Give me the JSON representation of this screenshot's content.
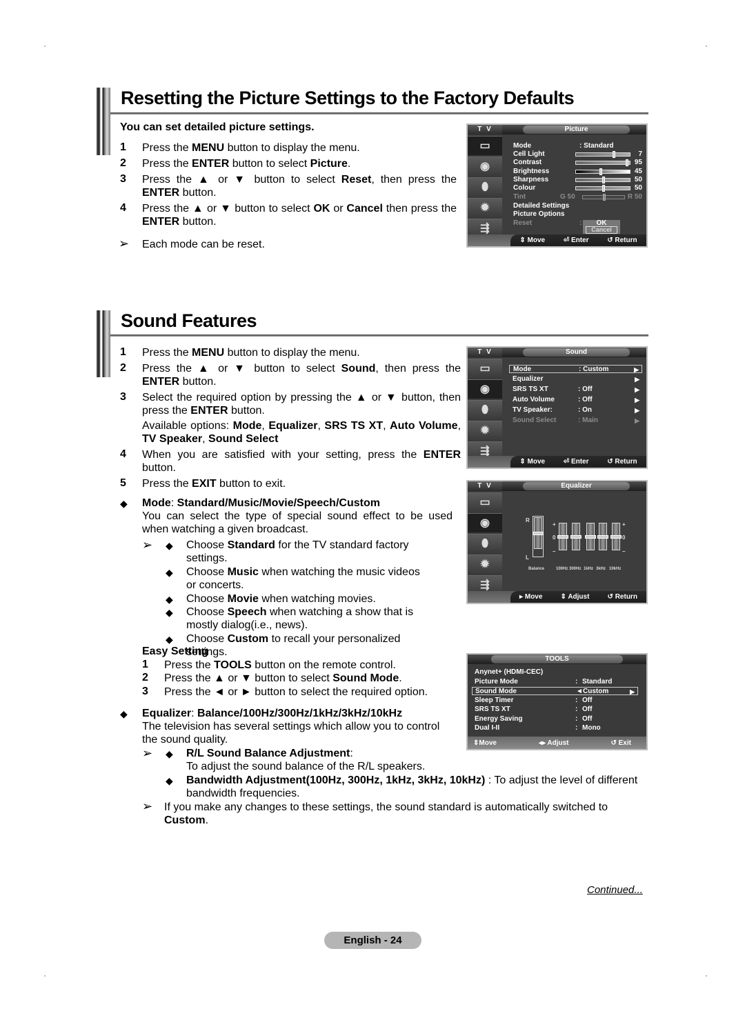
{
  "section1": {
    "title": "Resetting the Picture Settings to the Factory Defaults",
    "intro": "You can set detailed picture settings.",
    "steps": [
      {
        "n": "1",
        "parts": [
          [
            "Press the ",
            false
          ],
          [
            "MENU",
            true
          ],
          [
            " button to display the menu.",
            false
          ]
        ]
      },
      {
        "n": "2",
        "parts": [
          [
            "Press the ",
            false
          ],
          [
            "ENTER",
            true
          ],
          [
            " button to select ",
            false
          ],
          [
            "Picture",
            true
          ],
          [
            ".",
            false
          ]
        ]
      },
      {
        "n": "3",
        "parts": [
          [
            "Press the ▲ or ▼ button to select ",
            false
          ],
          [
            "Reset",
            true
          ],
          [
            ", then press the ",
            false
          ],
          [
            "ENTER",
            true
          ],
          [
            " button.",
            false
          ]
        ]
      },
      {
        "n": "4",
        "parts": [
          [
            "Press the ▲ or ▼ button to select ",
            false
          ],
          [
            "OK",
            true
          ],
          [
            " or ",
            false
          ],
          [
            "Cancel",
            true
          ],
          [
            " then press the ",
            false
          ],
          [
            "ENTER",
            true
          ],
          [
            " button.",
            false
          ]
        ]
      }
    ],
    "note": "Each mode can be reset."
  },
  "osd_picture": {
    "tv_label": "T V",
    "title": "Picture",
    "icons": [
      "picture-icon",
      "sound-icon",
      "channel-icon",
      "setup-icon",
      "input-icon"
    ],
    "mode_label": "Mode",
    "mode_value": ": Standard",
    "sliders": [
      {
        "label": "Cell Light",
        "value": "7",
        "level": 7,
        "max": 10,
        "dim": false
      },
      {
        "label": "Contrast",
        "value": "95",
        "level": 95,
        "max": 100,
        "dim": false
      },
      {
        "label": "Brightness",
        "value": "45",
        "level": 45,
        "max": 100,
        "dim": false
      },
      {
        "label": "Sharpness",
        "value": "50",
        "level": 50,
        "max": 100,
        "dim": false
      },
      {
        "label": "Colour",
        "value": "50",
        "level": 50,
        "max": 100,
        "dim": false
      }
    ],
    "tint": {
      "label": "Tint",
      "left": "G  50",
      "right": "R  50",
      "level": 50
    },
    "detailed": "Detailed Settings",
    "options": "Picture Options",
    "reset_label": "Reset",
    "reset_sep": ":",
    "ok": "OK",
    "cancel": "Cancel",
    "footer": {
      "move": "Move",
      "enter": "Enter",
      "return": "Return"
    }
  },
  "section2": {
    "title": "Sound Features",
    "steps": [
      {
        "n": "1",
        "parts": [
          [
            "Press the ",
            false
          ],
          [
            "MENU",
            true
          ],
          [
            " button to display the menu.",
            false
          ]
        ]
      },
      {
        "n": "2",
        "parts": [
          [
            "Press the ▲ or ▼ button to select ",
            false
          ],
          [
            "Sound",
            true
          ],
          [
            ", then press the ",
            false
          ],
          [
            "ENTER",
            true
          ],
          [
            " button.",
            false
          ]
        ]
      },
      {
        "n": "3",
        "parts": [
          [
            "Select the required option by pressing the ▲ or ▼ button, then press the ",
            false
          ],
          [
            "ENTER",
            true
          ],
          [
            " button.",
            false
          ]
        ]
      },
      {
        "n": "",
        "parts": [
          [
            "Available options: ",
            false
          ],
          [
            "Mode",
            true
          ],
          [
            ", ",
            false
          ],
          [
            "Equalizer",
            true
          ],
          [
            ", ",
            false
          ],
          [
            "SRS TS XT",
            true
          ],
          [
            ", ",
            false
          ],
          [
            "Auto Volume",
            true
          ],
          [
            ", ",
            false
          ],
          [
            "TV Speaker",
            true
          ],
          [
            ", ",
            false
          ],
          [
            "Sound Select",
            true
          ]
        ]
      },
      {
        "n": "4",
        "parts": [
          [
            "When you are satisfied with your setting, press the ",
            false
          ],
          [
            "ENTER",
            true
          ],
          [
            " button.",
            false
          ]
        ]
      },
      {
        "n": "5",
        "parts": [
          [
            "Press the ",
            false
          ],
          [
            "EXIT",
            true
          ],
          [
            " button to exit.",
            false
          ]
        ]
      }
    ],
    "mode_heading": [
      [
        "Mode",
        true
      ],
      [
        ": ",
        false
      ],
      [
        "Standard/Music/Movie/Speech/Custom",
        true
      ]
    ],
    "mode_desc": "You can select the type of special sound effect to be used when watching a given broadcast.",
    "mode_bullets": [
      [
        [
          "Choose ",
          false
        ],
        [
          "Standard",
          true
        ],
        [
          " for the TV standard factory settings.",
          false
        ]
      ],
      [
        [
          "Choose ",
          false
        ],
        [
          "Music",
          true
        ],
        [
          " when watching the music videos or concerts.",
          false
        ]
      ],
      [
        [
          "Choose ",
          false
        ],
        [
          "Movie",
          true
        ],
        [
          " when watching movies.",
          false
        ]
      ],
      [
        [
          "Choose ",
          false
        ],
        [
          "Speech",
          true
        ],
        [
          " when watching a show that is mostly dialog(i.e., news).",
          false
        ]
      ],
      [
        [
          "Choose ",
          false
        ],
        [
          "Custom",
          true
        ],
        [
          " to recall your personalized settings.",
          false
        ]
      ]
    ],
    "easy_heading": "Easy Setting",
    "easy_steps": [
      {
        "n": "1",
        "parts": [
          [
            "Press the ",
            false
          ],
          [
            "TOOLS",
            true
          ],
          [
            " button on the remote control.",
            false
          ]
        ]
      },
      {
        "n": "2",
        "parts": [
          [
            "Press the ▲ or ▼ button to select ",
            false
          ],
          [
            "Sound Mode",
            true
          ],
          [
            ".",
            false
          ]
        ]
      },
      {
        "n": "3",
        "parts": [
          [
            "Press the ◄ or ► button to select the required option.",
            false
          ]
        ]
      }
    ],
    "eq_heading": [
      [
        "Equalizer",
        true
      ],
      [
        ": ",
        false
      ],
      [
        "Balance/100Hz/300Hz/1kHz/3kHz/10kHz",
        true
      ]
    ],
    "eq_desc": "The television has several settings which allow you to control the sound quality.",
    "eq_bullets": [
      {
        "head": "R/L Sound Balance Adjustment",
        "tail": ":",
        "desc": "To adjust the sound balance of the R/L speakers."
      },
      {
        "head": "Bandwidth Adjustment(100Hz, 300Hz, 1kHz, 3kHz, 10kHz)",
        "tail": " : To adjust the level of different bandwidth frequencies.",
        "desc": ""
      }
    ],
    "final_note": [
      [
        "If you make any changes to these settings, the sound standard is automatically switched to ",
        false
      ],
      [
        "Custom",
        true
      ],
      [
        ".",
        false
      ]
    ]
  },
  "osd_sound": {
    "tv_label": "T V",
    "title": "Sound",
    "rows": [
      {
        "label": "Mode",
        "value": ": Custom",
        "chev": "▶",
        "dim": false,
        "selected": true
      },
      {
        "label": "Equalizer",
        "value": "",
        "chev": "▶",
        "dim": false,
        "selected": false
      },
      {
        "label": "SRS TS XT",
        "value": ": Off",
        "chev": "▶",
        "dim": false,
        "selected": false
      },
      {
        "label": "Auto Volume",
        "value": ": Off",
        "chev": "▶",
        "dim": false,
        "selected": false
      },
      {
        "label": "TV Speaker:",
        "value": ": On",
        "chev": "▶",
        "dim": false,
        "selected": false
      },
      {
        "label": "Sound Select",
        "value": ": Main",
        "chev": "▶",
        "dim": true,
        "selected": false
      }
    ],
    "footer": {
      "move": "Move",
      "enter": "Enter",
      "return": "Return"
    }
  },
  "osd_equalizer": {
    "tv_label": "T V",
    "title": "Equalizer",
    "balance_top": "R",
    "balance_bottom": "L",
    "plus": "+",
    "zero": "0",
    "minus": "–",
    "bands": [
      {
        "label": "Balance",
        "level": 0
      },
      {
        "label": "100Hz",
        "level": 0
      },
      {
        "label": "300Hz",
        "level": 0
      },
      {
        "label": "1kHz",
        "level": 0
      },
      {
        "label": "3kHz",
        "level": 0
      },
      {
        "label": "10kHz",
        "level": 0
      }
    ],
    "footer": {
      "move": "Move",
      "adjust": "Adjust",
      "return": "Return"
    }
  },
  "osd_tools": {
    "title": "TOOLS",
    "rows": [
      {
        "label": "Anynet+ (HDMI-CEC)",
        "sep": "",
        "value": "",
        "selected": false
      },
      {
        "label": "Picture Mode",
        "sep": ":",
        "value": "Standard",
        "selected": false
      },
      {
        "label": "Sound Mode",
        "sep": "◄",
        "value": "Custom",
        "selected": true,
        "chev": "▶"
      },
      {
        "label": "Sleep Timer",
        "sep": ":",
        "value": "Off",
        "selected": false
      },
      {
        "label": "SRS TS XT",
        "sep": ":",
        "value": "Off",
        "selected": false
      },
      {
        "label": "Energy Saving",
        "sep": ":",
        "value": "Off",
        "selected": false
      },
      {
        "label": "Dual I-II",
        "sep": ":",
        "value": "Mono",
        "selected": false
      }
    ],
    "footer": {
      "move": "Move",
      "adjust": "Adjust",
      "exit": "Exit"
    }
  },
  "continued": "Continued...",
  "page_label": "English - 24"
}
